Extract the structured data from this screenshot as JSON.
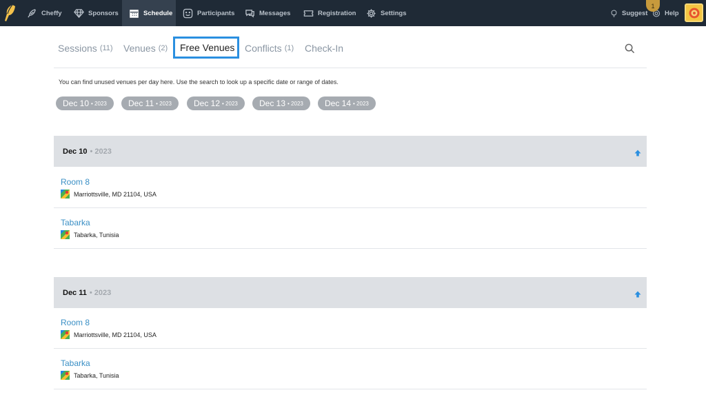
{
  "nav": {
    "items": [
      {
        "label": "Cheffy",
        "icon": "feather-icon"
      },
      {
        "label": "Sponsors",
        "icon": "diamond-icon"
      },
      {
        "label": "Schedule",
        "icon": "calendar-icon"
      },
      {
        "label": "Participants",
        "icon": "face-icon"
      },
      {
        "label": "Messages",
        "icon": "chat-icon"
      },
      {
        "label": "Registration",
        "icon": "ticket-icon"
      },
      {
        "label": "Settings",
        "icon": "gear-icon"
      }
    ],
    "suggest": "Suggest",
    "help": "Help",
    "notification_count": "1",
    "active_item": "Schedule"
  },
  "tabs": [
    {
      "label": "Sessions",
      "count": "(11)"
    },
    {
      "label": "Venues",
      "count": "(2)"
    },
    {
      "label": "Free Venues",
      "count": ""
    },
    {
      "label": "Conflicts",
      "count": "(1)"
    },
    {
      "label": "Check-In",
      "count": ""
    }
  ],
  "active_tab": "Free Venues",
  "intro": "You can find unused venues per day here. Use the search to look up a specific date or range of dates.",
  "date_chips": [
    {
      "day": "Dec 10",
      "year": "• 2023"
    },
    {
      "day": "Dec 11",
      "year": "• 2023"
    },
    {
      "day": "Dec 12",
      "year": "• 2023"
    },
    {
      "day": "Dec 13",
      "year": "• 2023"
    },
    {
      "day": "Dec 14",
      "year": "• 2023"
    }
  ],
  "days": [
    {
      "day": "Dec 10",
      "year": "• 2023",
      "venues": [
        {
          "name": "Room 8",
          "address": "Marriottsville, MD 21104, USA"
        },
        {
          "name": "Tabarka",
          "address": "Tabarka, Tunisia"
        }
      ]
    },
    {
      "day": "Dec 11",
      "year": "• 2023",
      "venues": [
        {
          "name": "Room 8",
          "address": "Marriottsville, MD 21104, USA"
        },
        {
          "name": "Tabarka",
          "address": "Tabarka, Tunisia"
        }
      ]
    }
  ],
  "colors": {
    "topbar": "#1f2a36",
    "accent": "#2a8fe0",
    "link": "#3a8fc5",
    "chip": "#a6abb1",
    "day_header": "#dde0e4"
  }
}
